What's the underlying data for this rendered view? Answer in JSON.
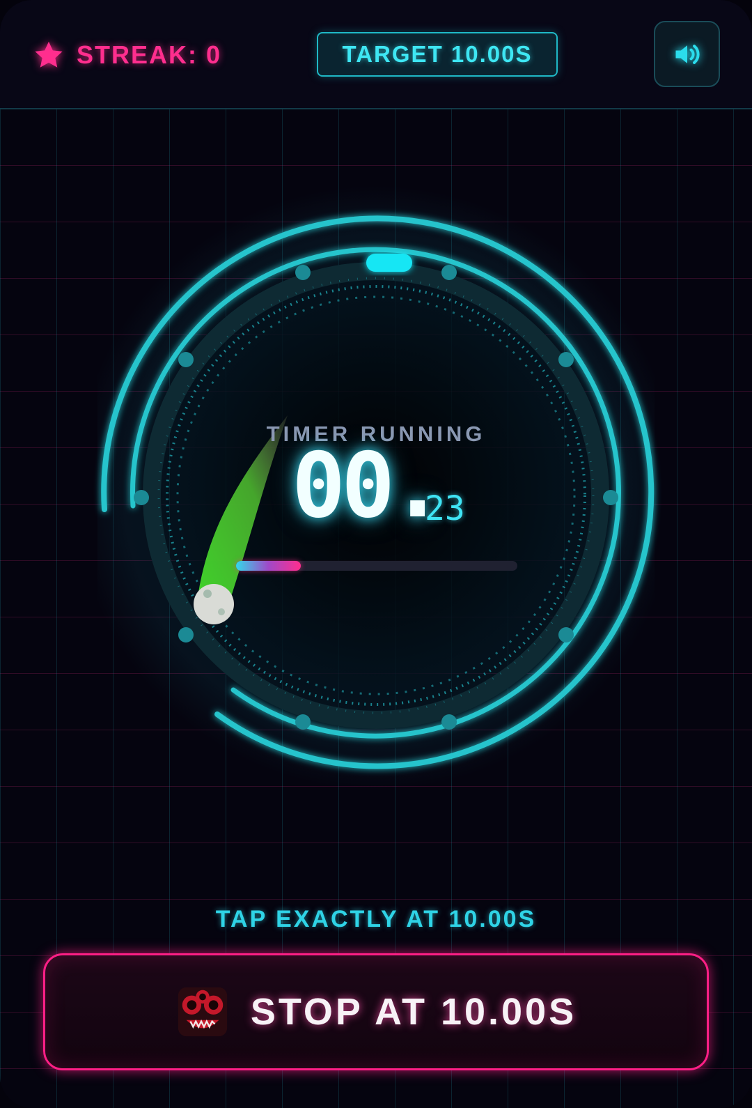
{
  "header": {
    "streak_label": "STREAK: 0",
    "target_label": "TARGET 10.00S"
  },
  "icons": {
    "streak": "star-icon",
    "sound": "speaker-volume-icon",
    "button": "monster-icon"
  },
  "timer": {
    "status": "TIMER RUNNING",
    "seconds": "00.",
    "fraction": "23",
    "progress_percent": 23
  },
  "prompt": {
    "hint": "TAP EXACTLY AT 10.00S",
    "stop_label": "STOP AT 10.00S"
  },
  "colors": {
    "accent_cyan": "#2fd3e6",
    "accent_pink": "#ff2e8e",
    "comet_green": "#3fd12a",
    "background": "#060512"
  }
}
